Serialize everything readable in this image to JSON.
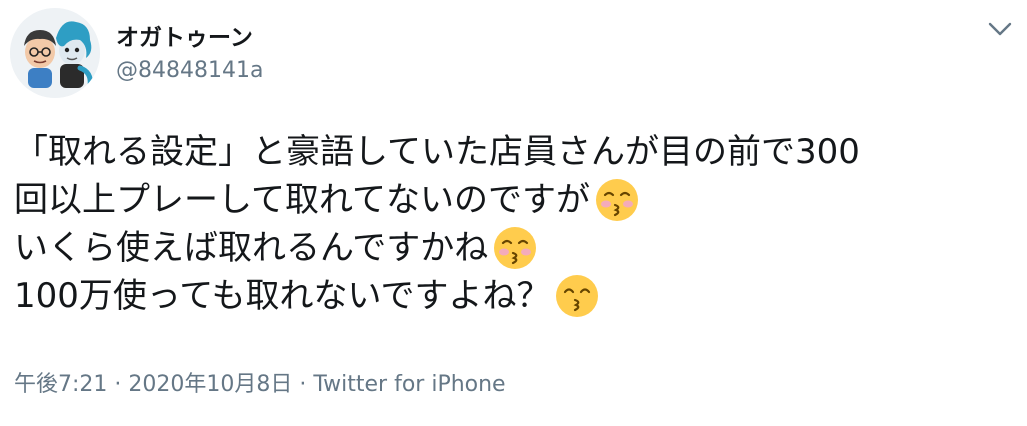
{
  "user": {
    "display_name": "オガトゥーン",
    "handle": "@84848141a"
  },
  "menu": {
    "icon": "chevron-down-icon"
  },
  "tweet": {
    "lines": [
      "「取れる設定」と豪語していた店員さんが目の前で300",
      "回以上プレーして取れてないのですが",
      "いくら使えば取れるんですかね",
      "100万使っても取れないですよね？"
    ],
    "emojis": [
      "kissing-face-with-closed-eyes",
      "kissing-face-with-closed-eyes",
      "kissing-face-with-smiling-eyes"
    ]
  },
  "meta": {
    "time": "午後7:21",
    "separator1": " · ",
    "date": "2020年10月8日",
    "separator2": " · ",
    "source": "Twitter for iPhone"
  }
}
